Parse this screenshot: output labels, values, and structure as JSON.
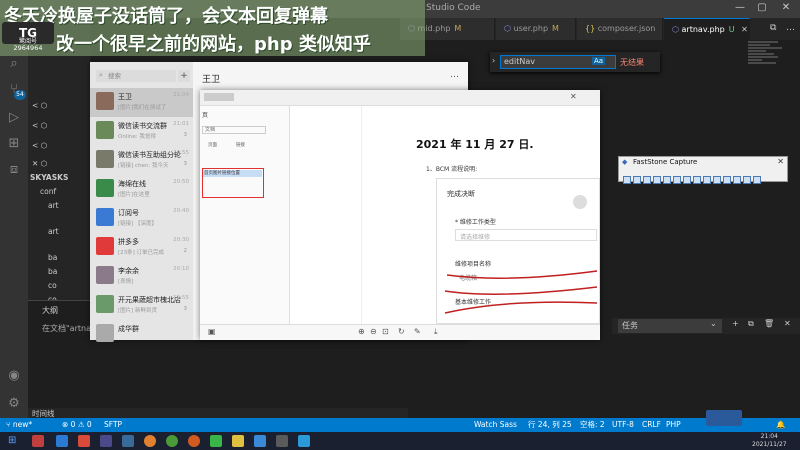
{
  "overlay": {
    "line1": "冬天冷换屋子没话筒了，会文本回复弹幕",
    "line2": "改一个很早之前的网站，php 类似知乎",
    "logo_text": "鹭阅号",
    "logo_id": "2964964"
  },
  "vscode": {
    "title": "Studio Code",
    "tabs": [
      {
        "label": "mid.php",
        "modified": "M"
      },
      {
        "label": "user.php",
        "modified": "M"
      },
      {
        "label": "composer.json",
        "modified": ""
      },
      {
        "label": "artnav.php",
        "modified": "U"
      }
    ],
    "find": {
      "query": "editNav",
      "case_toggle": "Aa",
      "result": "无结果"
    },
    "badge": "54",
    "sidebar_rows": [
      "< ⬡",
      "< ⬡",
      "< ⬡",
      "✕ ⬡",
      "SKYASKS",
      "conf",
      "art",
      "art",
      "ba",
      "ba",
      "co",
      "co"
    ],
    "bottom_panel_title": "大纲",
    "bottom_panel_msg": "在文档\"artnav.php\"中找不到符号",
    "task_label": "任务",
    "timeline_label": "时间线",
    "status": {
      "branch": "new*",
      "errors": "⊗ 0 ⚠ 0",
      "sftp": "SFTP",
      "watch": "Watch Sass",
      "position": "行 24, 列 25",
      "spaces": "空格: 2",
      "encoding": "UTF-8",
      "eol": "CRLF",
      "lang": "PHP"
    }
  },
  "wechat": {
    "search_placeholder": "搜索",
    "header": "王卫",
    "chats": [
      {
        "name": "王卫",
        "preview": "[图片]我们在测试了",
        "time": "21:04",
        "count": "",
        "color": "#8a6a5a"
      },
      {
        "name": "微信读书交流群",
        "preview": "Online: 我觉得",
        "time": "21:01",
        "count": "3",
        "color": "#6a8a5a"
      },
      {
        "name": "微信读书互助组分轮",
        "preview": "[链接] chen: 我今天",
        "time": "20:55",
        "count": "3",
        "color": "#7a7a6a"
      },
      {
        "name": "海绵在线",
        "preview": "[图片]在这里",
        "time": "20:50",
        "count": "",
        "color": "#3a8a4a"
      },
      {
        "name": "订阅号",
        "preview": "[链接] 【深度】",
        "time": "20:40",
        "count": "",
        "color": "#3a7ad4"
      },
      {
        "name": "拼多多",
        "preview": "[23条] 订单已完成",
        "time": "20:30",
        "count": "2",
        "color": "#e03a3a"
      },
      {
        "name": "李余余",
        "preview": "[表情]",
        "time": "20:10",
        "count": "",
        "color": "#8a7a8a"
      },
      {
        "name": "开元果蔬超市槐北店",
        "preview": "[图片] 新鲜到货",
        "time": "19:55",
        "count": "3",
        "color": "#6a9a6a"
      },
      {
        "name": "成华群",
        "preview": "",
        "time": "",
        "count": "",
        "color": "#aaaaaa"
      }
    ]
  },
  "doc": {
    "title": "2021 年 11 月 27 日.",
    "subtitle": "1、BCM 流程说明:",
    "left_header": "页",
    "left_search": "文档",
    "left_cols": [
      "页面",
      "链接"
    ],
    "selected_row": "首页图片链接位置",
    "form": {
      "heading": "完成决断",
      "field1": "* 维修工作类型",
      "field1_placeholder": "请选择维修",
      "field2": "维修项目名称",
      "field2_value": "电缆箱",
      "field3": "基本维修工作"
    }
  },
  "faststone": {
    "title": "FastStone Capture"
  },
  "clock": {
    "time": "21:04",
    "date": "2021/11/27"
  }
}
